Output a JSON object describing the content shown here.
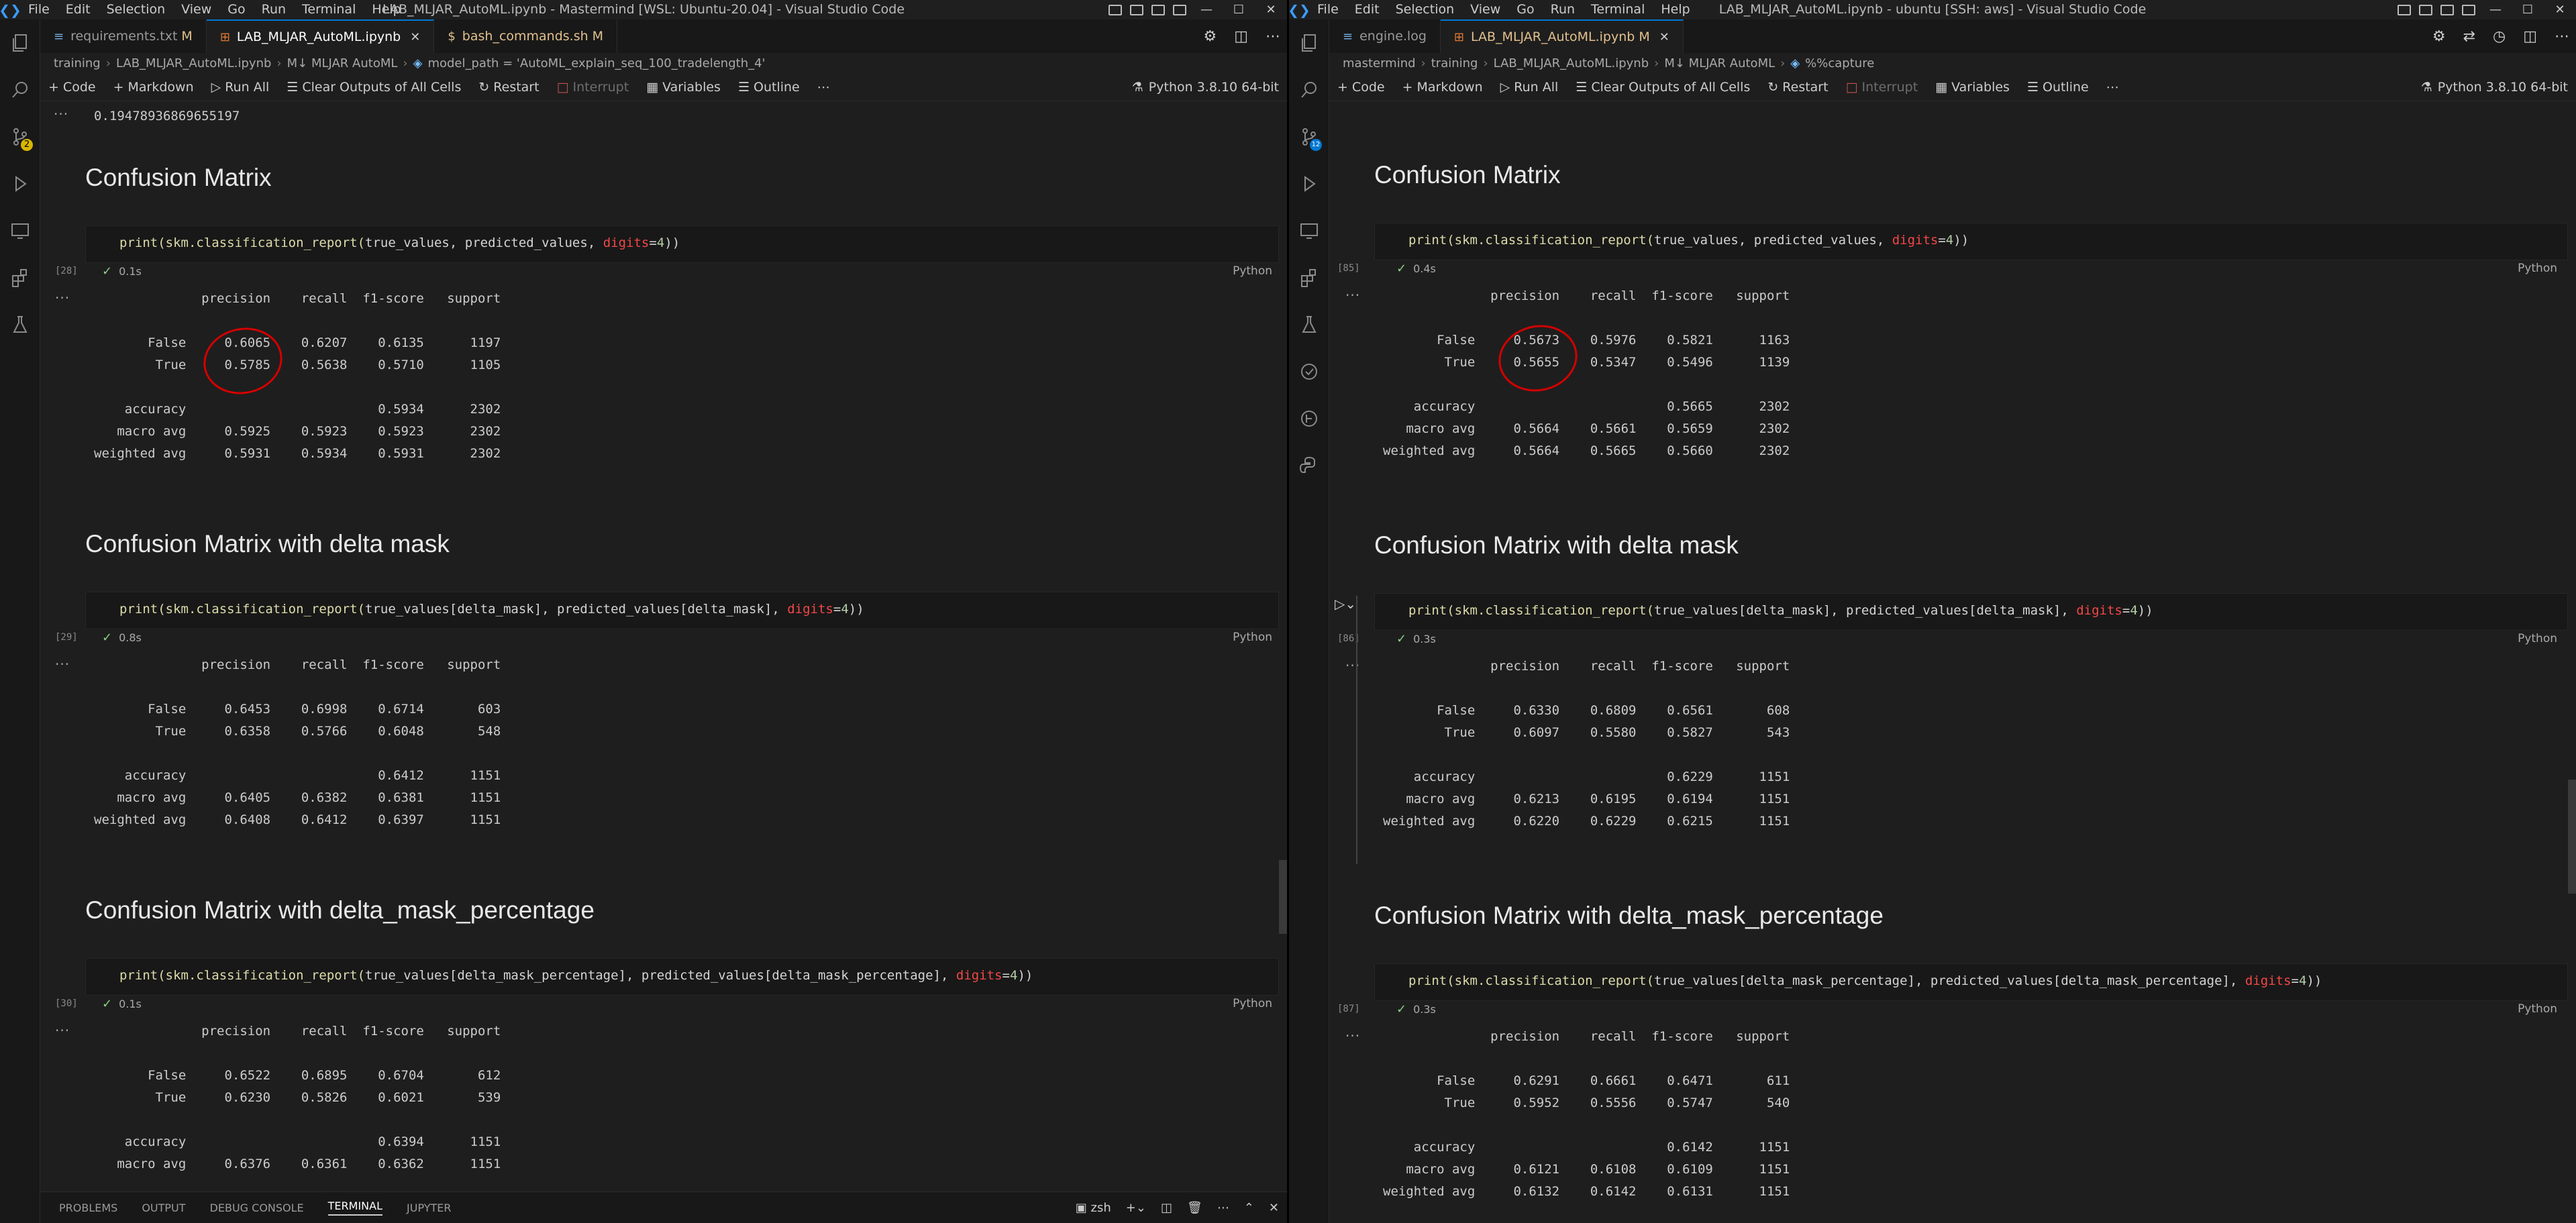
{
  "left": {
    "title": "LAB_MLJAR_AutoML.ipynb - Mastermind [WSL: Ubuntu-20.04] - Visual Studio Code",
    "menu": [
      "File",
      "Edit",
      "Selection",
      "View",
      "Go",
      "Run",
      "Terminal",
      "Help"
    ],
    "tabs": [
      {
        "icon": "≡",
        "label": "requirements.txt",
        "mod": "M",
        "active": false
      },
      {
        "icon": "⊞",
        "label": "LAB_MLJAR_AutoML.ipynb",
        "mod": "",
        "active": true
      },
      {
        "icon": "$",
        "label": "bash_commands.sh",
        "mod": "M",
        "active": false
      }
    ],
    "breadcrumbs": [
      "training",
      "LAB_MLJAR_AutoML.ipynb",
      "M↓ MLJAR AutoML",
      "model_path = 'AutoML_explain_seq_100_tradelength_4'"
    ],
    "toolbar": {
      "code": "Code",
      "markdown": "Markdown",
      "run_all": "Run All",
      "clear": "Clear Outputs of All Cells",
      "restart": "Restart",
      "interrupt": "Interrupt",
      "variables": "Variables",
      "outline": "Outline"
    },
    "kernel": "Python 3.8.10 64-bit",
    "top_output": "0.19478936869655197",
    "sections": [
      {
        "heading": "Confusion Matrix",
        "code_prefix": "print(skm.classification_report(",
        "code_a": "true_values",
        "code_b": ", ",
        "code_c": "predicted_values",
        "code_d": ", ",
        "code_arg": "digits",
        "code_eq": "=",
        "code_num": "4",
        "code_end": "))",
        "cell": "[28]",
        "time": "0.1s",
        "lang": "Python",
        "report": "              precision    recall  f1-score   support\n\n       False     0.6065    0.6207    0.6135      1197\n        True     0.5785    0.5638    0.5710      1105\n\n    accuracy                         0.5934      2302\n   macro avg     0.5925    0.5923    0.5923      2302\nweighted avg     0.5931    0.5934    0.5931      2302"
      },
      {
        "heading": "Confusion Matrix with delta mask",
        "code_prefix": "print(skm.classification_report(",
        "code_a": "true_values[delta_mask]",
        "code_b": ", ",
        "code_c": "predicted_values[delta_mask]",
        "code_d": ", ",
        "code_arg": "digits",
        "code_eq": "=",
        "code_num": "4",
        "code_end": "))",
        "cell": "[29]",
        "time": "0.8s",
        "lang": "Python",
        "report": "              precision    recall  f1-score   support\n\n       False     0.6453    0.6998    0.6714       603\n        True     0.6358    0.5766    0.6048       548\n\n    accuracy                         0.6412      1151\n   macro avg     0.6405    0.6382    0.6381      1151\nweighted avg     0.6408    0.6412    0.6397      1151"
      },
      {
        "heading": "Confusion Matrix with delta_mask_percentage",
        "code_prefix": "print(skm.classification_report(",
        "code_a": "true_values[delta_mask_percentage]",
        "code_b": ", ",
        "code_c": "predicted_values[delta_mask_percentage]",
        "code_d": ", ",
        "code_arg": "digits",
        "code_eq": "=",
        "code_num": "4",
        "code_end": "))",
        "cell": "[30]",
        "time": "0.1s",
        "lang": "Python",
        "report": "              precision    recall  f1-score   support\n\n       False     0.6522    0.6895    0.6704       612\n        True     0.6230    0.5826    0.6021       539\n\n    accuracy                         0.6394      1151\n   macro avg     0.6376    0.6361    0.6362      1151"
      }
    ],
    "panel": {
      "tabs": [
        "PROBLEMS",
        "OUTPUT",
        "DEBUG CONSOLE",
        "TERMINAL",
        "JUPYTER"
      ],
      "shell": "zsh"
    }
  },
  "right": {
    "title": "LAB_MLJAR_AutoML.ipynb - ubuntu [SSH: aws] - Visual Studio Code",
    "menu": [
      "File",
      "Edit",
      "Selection",
      "View",
      "Go",
      "Run",
      "Terminal",
      "Help"
    ],
    "tabs": [
      {
        "icon": "≡",
        "label": "engine.log",
        "mod": "",
        "active": false
      },
      {
        "icon": "⊞",
        "label": "LAB_MLJAR_AutoML.ipynb",
        "mod": "M",
        "active": true
      }
    ],
    "breadcrumbs": [
      "mastermind",
      "training",
      "LAB_MLJAR_AutoML.ipynb",
      "M↓ MLJAR AutoML",
      "%%capture"
    ],
    "toolbar": {
      "code": "Code",
      "markdown": "Markdown",
      "run_all": "Run All",
      "clear": "Clear Outputs of All Cells",
      "restart": "Restart",
      "interrupt": "Interrupt",
      "variables": "Variables",
      "outline": "Outline"
    },
    "kernel": "Python 3.8.10 64-bit",
    "sections": [
      {
        "heading": "Confusion Matrix",
        "code_prefix": "print(skm.classification_report(",
        "code_a": "true_values",
        "code_b": ", ",
        "code_c": "predicted_values",
        "code_d": ", ",
        "code_arg": "digits",
        "code_eq": "=",
        "code_num": "4",
        "code_end": "))",
        "cell": "[85]",
        "time": "0.4s",
        "lang": "Python",
        "report": "              precision    recall  f1-score   support\n\n       False     0.5673    0.5976    0.5821      1163\n        True     0.5655    0.5347    0.5496      1139\n\n    accuracy                         0.5665      2302\n   macro avg     0.5664    0.5661    0.5659      2302\nweighted avg     0.5664    0.5665    0.5660      2302"
      },
      {
        "heading": "Confusion Matrix with delta mask",
        "code_prefix": "print(skm.classification_report(",
        "code_a": "true_values[delta_mask]",
        "code_b": ", ",
        "code_c": "predicted_values[delta_mask]",
        "code_d": ", ",
        "code_arg": "digits",
        "code_eq": "=",
        "code_num": "4",
        "code_end": "))",
        "cell": "[86]",
        "time": "0.3s",
        "lang": "Python",
        "report": "              precision    recall  f1-score   support\n\n       False     0.6330    0.6809    0.6561       608\n        True     0.6097    0.5580    0.5827       543\n\n    accuracy                         0.6229      1151\n   macro avg     0.6213    0.6195    0.6194      1151\nweighted avg     0.6220    0.6229    0.6215      1151"
      },
      {
        "heading": "Confusion Matrix with delta_mask_percentage",
        "code_prefix": "print(skm.classification_report(",
        "code_a": "true_values[delta_mask_percentage]",
        "code_b": ", ",
        "code_c": "predicted_values[delta_mask_percentage]",
        "code_d": ", ",
        "code_arg": "digits",
        "code_eq": "=",
        "code_num": "4",
        "code_end": "))",
        "cell": "[87]",
        "time": "0.3s",
        "lang": "Python",
        "report": "              precision    recall  f1-score   support\n\n       False     0.6291    0.6661    0.6471       611\n        True     0.5952    0.5556    0.5747       540\n\n    accuracy                         0.6142      1151\n   macro avg     0.6121    0.6108    0.6109      1151\nweighted avg     0.6132    0.6142    0.6131      1151"
      }
    ]
  },
  "colors": {
    "accent": "#0078d4",
    "annotation": "#d40000",
    "check": "#89d185",
    "badge": "#d7b600"
  }
}
